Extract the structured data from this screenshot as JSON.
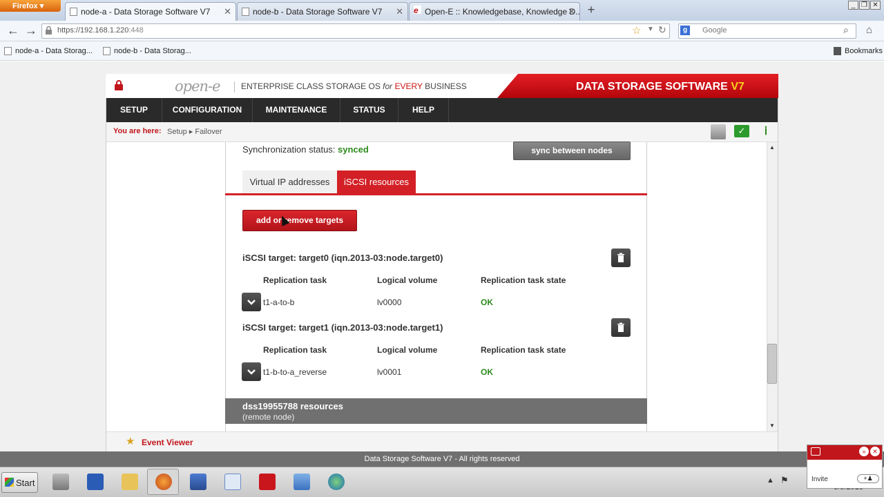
{
  "browser": {
    "menu_label": "Firefox",
    "tabs": [
      {
        "label": "node-a - Data Storage Software V7",
        "active": true
      },
      {
        "label": "node-b - Data Storage Software V7",
        "active": false
      },
      {
        "label": "Open-E :: Knowledgebase, Knowledge D...",
        "active": false
      }
    ],
    "url": "https://192.168.1.220",
    "url_port": ":448",
    "search_placeholder": "Google",
    "bookmarks": [
      "node-a - Data Storag...",
      "node-b - Data Storag..."
    ],
    "bookmarks_menu": "Bookmarks"
  },
  "header": {
    "logo": "open-e",
    "tagline_pre": "ENTERPRISE CLASS STORAGE OS ",
    "tagline_for": "for",
    "tagline_every": " EVERY",
    "tagline_post": " BUSINESS",
    "brand": "DATA STORAGE SOFTWARE",
    "brand_version": "V7"
  },
  "menu": [
    "SETUP",
    "CONFIGURATION",
    "MAINTENANCE",
    "STATUS",
    "HELP"
  ],
  "breadcrumb": {
    "label": "You are here:",
    "items": [
      "Setup",
      "Failover"
    ]
  },
  "sync": {
    "label": "Synchronization status:",
    "value": "synced",
    "button": "sync between nodes"
  },
  "tabs": [
    "Virtual IP addresses",
    "iSCSI resources"
  ],
  "add_button": "add or remove targets",
  "targets": [
    {
      "title": "iSCSI target: target0 (iqn.2013-03:node.target0)",
      "columns": [
        "Replication task",
        "Logical volume",
        "Replication task state"
      ],
      "task": "t1-a-to-b",
      "volume": "lv0000",
      "state": "OK"
    },
    {
      "title": "iSCSI target: target1 (iqn.2013-03:node.target1)",
      "columns": [
        "Replication task",
        "Logical volume",
        "Replication task state"
      ],
      "task": "t1-b-to-a_reverse",
      "volume": "lv0001",
      "state": "OK"
    }
  ],
  "remote": {
    "title": "dss19955788 resources",
    "subtitle": "(remote node)"
  },
  "event_viewer": "Event Viewer",
  "footer": "Data Storage Software V7 - All rights reserved",
  "taskbar": {
    "start": "Start",
    "clock": "3/5/2013"
  },
  "chat": {
    "invite": "Invite",
    "pill": "+♟"
  },
  "colors": {
    "accent_red": "#d32026",
    "ok_green": "#2c8a1c",
    "menu_bg": "#2a2a2a"
  }
}
